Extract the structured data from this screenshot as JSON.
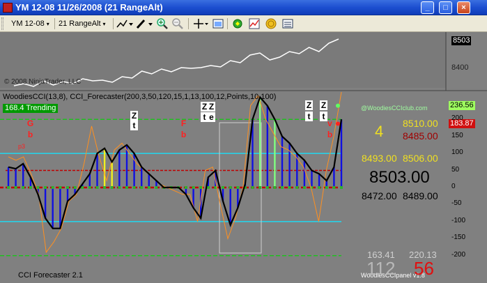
{
  "window": {
    "title": "YM 12-08  11/26/2008 (21 RangeAlt)",
    "btn_min": "_",
    "btn_max": "□",
    "btn_close": "×"
  },
  "toolbar": {
    "instrument": "YM 12-08",
    "interval": "21 RangeAlt",
    "caret": "▾"
  },
  "price_panel": {
    "copyright": "© 2008 NinjaTrader, LLC",
    "axis_labels": [
      "8503",
      "8400"
    ],
    "line": [
      77,
      74,
      78,
      70,
      76,
      71,
      74,
      67,
      70,
      69,
      72,
      64,
      66,
      56,
      60,
      53,
      57,
      51,
      52,
      51,
      48,
      50,
      41,
      44,
      33,
      30,
      40,
      36,
      28,
      31,
      22,
      28,
      16,
      10
    ]
  },
  "indicator": {
    "header": "WoodiesCCI(13,8), CCI_Forecaster(200,3,50,120,15,1,13,100,12,Points,10,100)",
    "trending": "168.4 Trending",
    "site": "@WoodiesCCIclub.com",
    "footer_left": "CCI Forecaster 2.1",
    "footer_right": "WoodiesCCIpanel v1.8",
    "value_green": "236.56",
    "value_red": "183.87",
    "axis_labels": [
      "200",
      "150",
      "100",
      "50",
      "0",
      "-50",
      "-100",
      "-150",
      "-200"
    ],
    "small_label": "p3",
    "cci": [
      60,
      55,
      70,
      30,
      -20,
      -90,
      -120,
      -120,
      -40,
      -20,
      10,
      40,
      100,
      115,
      75,
      110,
      125,
      100,
      60,
      40,
      20,
      0,
      0,
      0,
      -20,
      -60,
      -90,
      30,
      50,
      -40,
      -110,
      -60,
      10,
      200,
      265,
      240,
      200,
      150,
      130,
      100,
      80,
      50,
      40,
      20,
      60,
      200
    ],
    "turbo": [
      90,
      80,
      90,
      40,
      -20,
      -190,
      -160,
      -120,
      -40,
      -20,
      70,
      180,
      90,
      20,
      110,
      130,
      100,
      70,
      50,
      30,
      10,
      0,
      -10,
      -20,
      -20,
      -100,
      50,
      60,
      -50,
      -150,
      -90,
      0,
      240,
      270,
      200,
      160,
      120,
      110,
      90,
      60,
      0,
      -100,
      50,
      150,
      280
    ]
  },
  "letters": [
    {
      "text": "G",
      "color": "#ff2020"
    },
    {
      "text": "b",
      "color": "#ff2020"
    },
    {
      "text": "Z",
      "color": "#000000"
    },
    {
      "text": "t",
      "color": "#000000"
    },
    {
      "text": "F",
      "color": "#ff2020"
    },
    {
      "text": "b",
      "color": "#ff2020"
    },
    {
      "text": "Z",
      "color": "#000000"
    },
    {
      "text": "Z",
      "color": "#000000"
    },
    {
      "text": "t",
      "color": "#000000"
    },
    {
      "text": "e",
      "color": "#000000"
    },
    {
      "text": "Z",
      "color": "#000000"
    },
    {
      "text": "t",
      "color": "#000000"
    },
    {
      "text": "Z",
      "color": "#000000"
    },
    {
      "text": "t",
      "color": "#000000"
    },
    {
      "text": "v",
      "color": "#ff2020"
    },
    {
      "text": "b",
      "color": "#ff2020"
    }
  ],
  "panel": {
    "count": "4",
    "v1": "8510.00",
    "v2": "8485.00",
    "v3": "8493.00",
    "v4": "8506.00",
    "price": "8503.00",
    "v5": "8472.00",
    "v6": "8489.00",
    "bottom_left_small": "163.41",
    "bottom_right_small": "220.13",
    "bottom_left_big": "112",
    "bottom_right_big": "56"
  },
  "colors": {
    "background": "#808080",
    "green_line": "#20c020",
    "cyan_line": "#20d8f0",
    "red_line": "#c00000",
    "bar_blue": "#1010e0",
    "bar_yellow": "#f0f020",
    "bar_green": "#80ff80",
    "cci_line": "#000000",
    "turbo_line": "#ff9020"
  }
}
